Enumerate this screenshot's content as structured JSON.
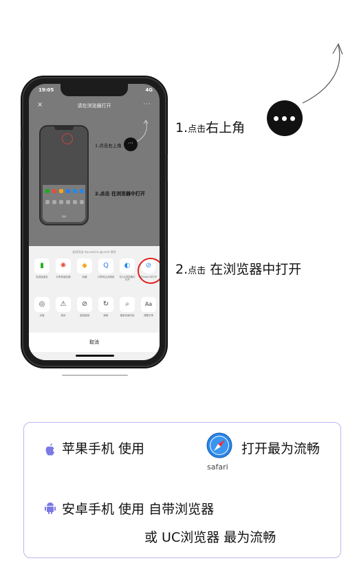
{
  "phone": {
    "status_time": "19:05",
    "status_signal": "4G",
    "title": "请在浏览器打开",
    "close_glyph": "×",
    "more_glyph": "···",
    "inner_label_1": "1.点击右上角",
    "inner_label_2": "2.点击 在浏览器中打开",
    "sheet_hint": "此网页由 mp.weixin.qq.com 提供",
    "row1": [
      {
        "label": "发送给朋友",
        "icon": "▮",
        "color": "#1aad19"
      },
      {
        "label": "分享到朋友圈",
        "icon": "✺",
        "color": "#e94c3d"
      },
      {
        "label": "收藏",
        "icon": "◆",
        "color": "#f5a623"
      },
      {
        "label": "分享到企业微信",
        "icon": "Q",
        "color": "#2f7de1"
      },
      {
        "label": "在QQ浏览器中打开",
        "icon": "◐",
        "color": "#1f8cf0"
      },
      {
        "label": "在Safari中打开",
        "icon": "⊘",
        "color": "#2a84e8"
      }
    ],
    "row2": [
      {
        "label": "浮窗",
        "icon": "◎",
        "color": "#333"
      },
      {
        "label": "投诉",
        "icon": "⚠",
        "color": "#333"
      },
      {
        "label": "复制链接",
        "icon": "⊘",
        "color": "#333"
      },
      {
        "label": "刷新",
        "icon": "↻",
        "color": "#333"
      },
      {
        "label": "搜索页面内容",
        "icon": "⌕",
        "color": "#333"
      },
      {
        "label": "调整字体",
        "icon": "Aa",
        "color": "#333"
      }
    ],
    "cancel": "取消"
  },
  "instructions": {
    "step1_num": "1.",
    "step1_small": "点击",
    "step1_text": "右上角",
    "step2_num": "2.",
    "step2_small": "点击",
    "step2_text": " 在浏览器中打开"
  },
  "info": {
    "apple_line": "苹果手机   使用",
    "apple_tail": "打开最为流畅",
    "safari_label": "safari",
    "android_line1": "安卓手机   使用 自带浏览器",
    "android_line2": "或 UC浏览器  最为流畅"
  },
  "colors": {
    "accent_purple": "#7b79e6",
    "highlight_red": "#e02020",
    "safari_blue": "#2a84e8"
  }
}
